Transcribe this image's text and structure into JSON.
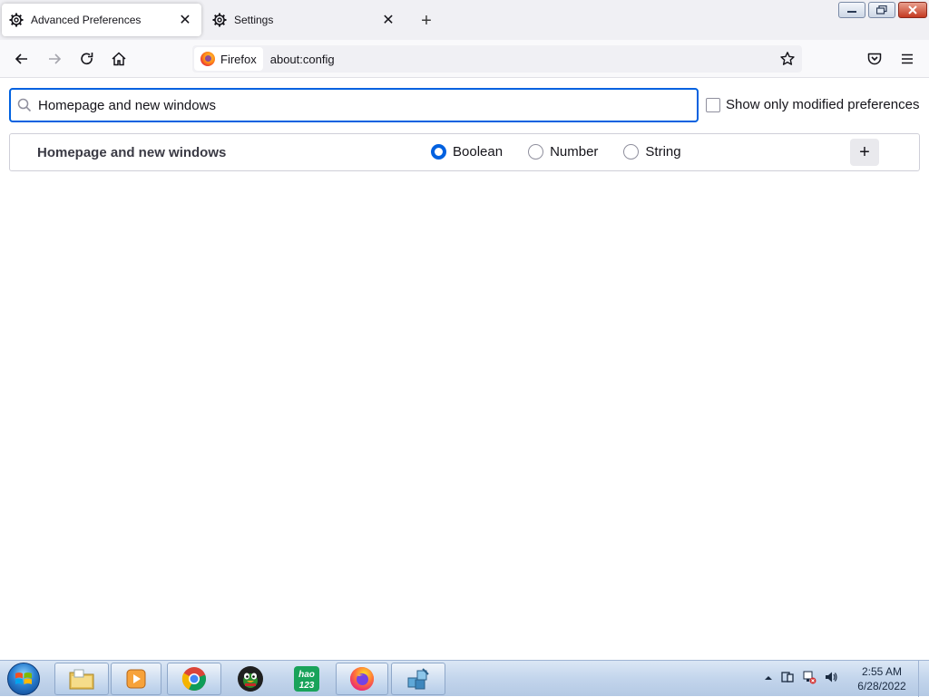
{
  "tabs": [
    {
      "title": "Advanced Preferences",
      "icon": "gear-icon",
      "active": true
    },
    {
      "title": "Settings",
      "icon": "gear-icon",
      "active": false
    }
  ],
  "navbar": {
    "identity_label": "Firefox",
    "url": "about:config"
  },
  "config": {
    "search_value": "Homepage and new windows",
    "show_modified_label": "Show only modified preferences",
    "new_pref_name": "Homepage and new windows",
    "types": [
      "Boolean",
      "Number",
      "String"
    ],
    "selected_type": "Boolean",
    "add_label": "+"
  },
  "taskbar": {
    "apps": [
      "file-explorer-icon",
      "media-player-icon",
      "chrome-icon",
      "qq-penguin-icon",
      "hao123-icon",
      "firefox-icon",
      "network-app-icon"
    ],
    "hao123_label": "hao\n123",
    "clock_time": "2:55 AM",
    "clock_date": "6/28/2022"
  },
  "colors": {
    "accent": "#0061e0",
    "tab_strip": "#f0f0f4",
    "taskbar": "#c3d5ec"
  }
}
